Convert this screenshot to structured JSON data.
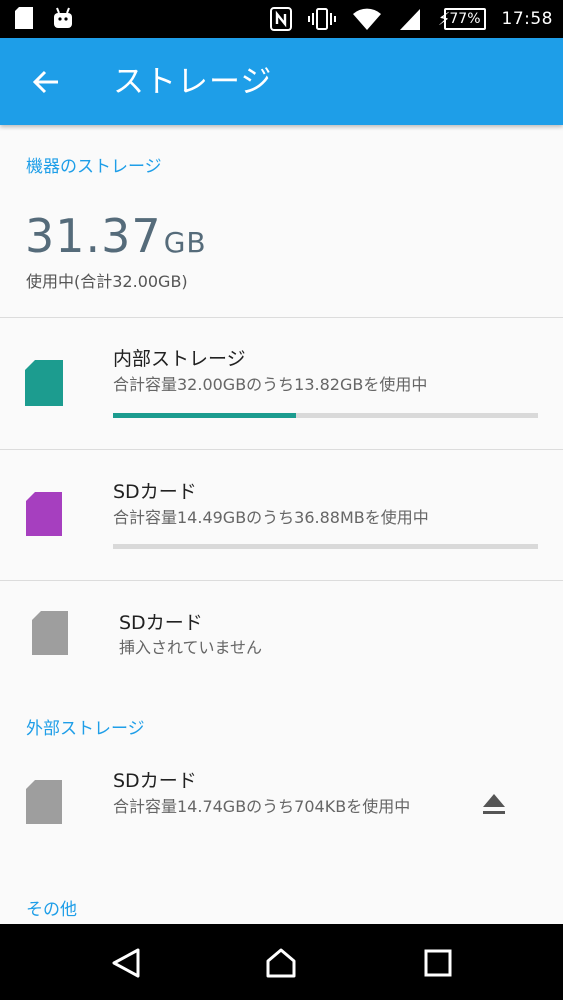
{
  "statusbar": {
    "battery": "77%",
    "time": "17:58"
  },
  "appbar": {
    "title": "ストレージ"
  },
  "device_storage": {
    "header": "機器のストレージ",
    "total_value": "31.37",
    "total_unit": "GB",
    "total_sub": "使用中(合計32.00GB)",
    "items": [
      {
        "title": "内部ストレージ",
        "subtitle": "合計容量32.00GBのうち13.82GBを使用中",
        "usage_fraction": 0.43,
        "color": "#1c9c8f"
      },
      {
        "title": "SDカード",
        "subtitle": "合計容量14.49GBのうち36.88MBを使用中",
        "usage_fraction": 0.0,
        "color": "#a63fbf"
      },
      {
        "title": "SDカード",
        "subtitle": "挿入されていません",
        "color": "#9e9e9e"
      }
    ]
  },
  "external_storage": {
    "header": "外部ストレージ",
    "items": [
      {
        "title": "SDカード",
        "subtitle": "合計容量14.74GBのうち704KBを使用中",
        "color": "#9e9e9e"
      }
    ]
  },
  "other": {
    "header": "その他"
  },
  "icons": [
    "sim-card-icon",
    "android-icon",
    "nfc-icon",
    "vibrate-icon",
    "wifi-icon",
    "signal-icon",
    "charging-icon",
    "back-arrow-icon",
    "sd-card-icon",
    "eject-icon",
    "nav-back-icon",
    "nav-home-icon",
    "nav-recents-icon"
  ],
  "colors": {
    "accent": "#1e9ee8",
    "internal_bar": "#1c9c8f",
    "sd_purple": "#a63fbf"
  }
}
